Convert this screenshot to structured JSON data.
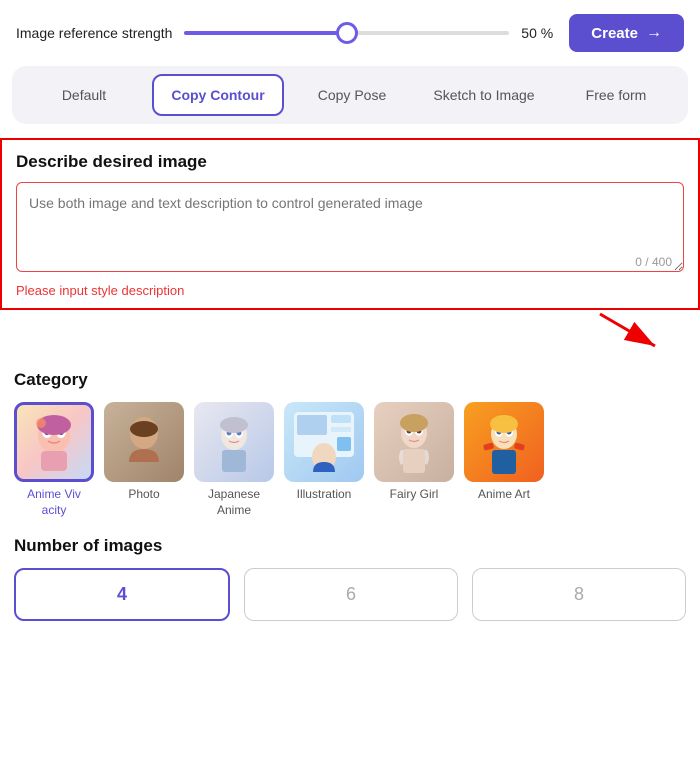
{
  "topBar": {
    "strengthLabel": "Image reference strength",
    "strengthValue": "50 %",
    "sliderPercent": 50,
    "createLabel": "Create"
  },
  "tabs": {
    "items": [
      {
        "id": "default",
        "label": "Default",
        "active": false
      },
      {
        "id": "copy-contour",
        "label": "Copy Contour",
        "active": true
      },
      {
        "id": "copy-pose",
        "label": "Copy Pose",
        "active": false
      },
      {
        "id": "sketch-to-image",
        "label": "Sketch to Image",
        "active": false
      },
      {
        "id": "free-form",
        "label": "Free form",
        "active": false
      }
    ]
  },
  "describeSection": {
    "title": "Describe desired image",
    "placeholder": "Use both image and text description to control generated image",
    "charCount": "0 / 400",
    "errorText": "Please input style description"
  },
  "categorySection": {
    "title": "Category",
    "items": [
      {
        "id": "anime-vivacity",
        "label": "Anime Vivacity",
        "selected": true,
        "colorClass": "cat-anime-viv"
      },
      {
        "id": "photo",
        "label": "Photo",
        "selected": false,
        "colorClass": "cat-photo"
      },
      {
        "id": "japanese-anime",
        "label": "Japanese Anime",
        "selected": false,
        "colorClass": "cat-japanese"
      },
      {
        "id": "illustration",
        "label": "Illustration",
        "selected": false,
        "colorClass": "cat-illustration"
      },
      {
        "id": "fairy-girl",
        "label": "Fairy Girl",
        "selected": false,
        "colorClass": "cat-fairy"
      },
      {
        "id": "anime-art",
        "label": "Anime Art",
        "selected": false,
        "colorClass": "cat-anime-art"
      }
    ]
  },
  "numImagesSection": {
    "title": "Number of images",
    "options": [
      {
        "value": "4",
        "selected": true
      },
      {
        "value": "6",
        "selected": false
      },
      {
        "value": "8",
        "selected": false
      }
    ]
  }
}
